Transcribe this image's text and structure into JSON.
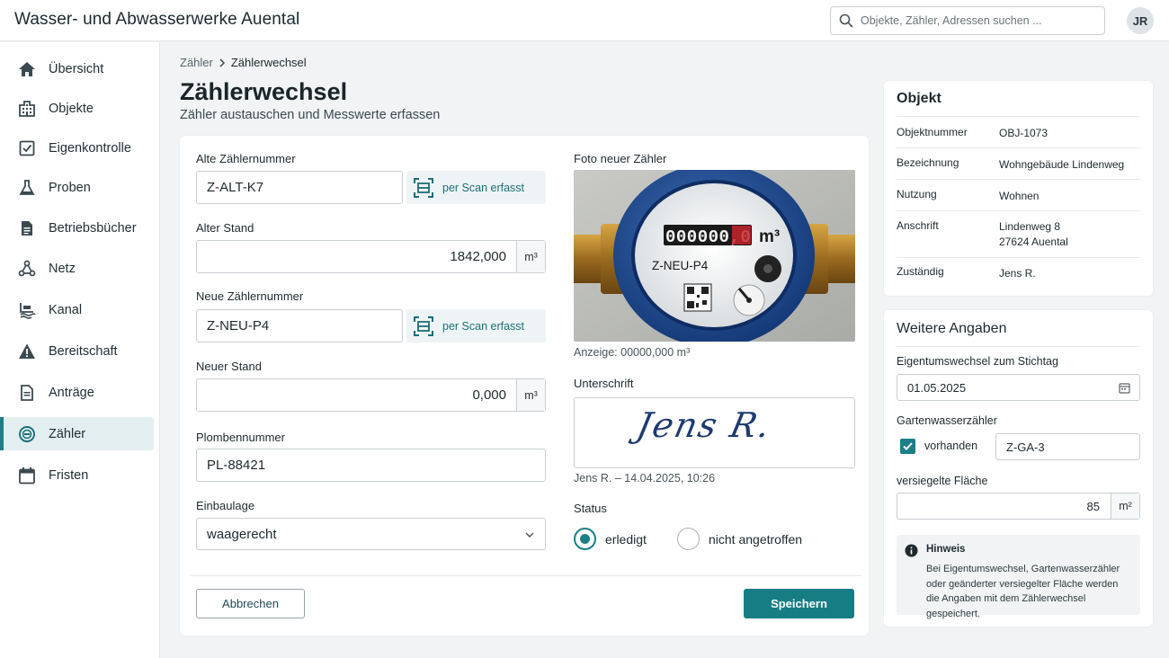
{
  "app": {
    "title": "Wasser- und Abwasserwerke Auental",
    "user_initials": "JR"
  },
  "search": {
    "placeholder": "Objekte, Zähler, Adressen suchen ..."
  },
  "sidebar": {
    "items": [
      {
        "label": "Übersicht",
        "icon": "home-icon"
      },
      {
        "label": "Objekte",
        "icon": "building-icon"
      },
      {
        "label": "Eigenkontrolle",
        "icon": "checklist-icon"
      },
      {
        "label": "Proben",
        "icon": "flask-icon"
      },
      {
        "label": "Betriebsbücher",
        "icon": "document-icon"
      },
      {
        "label": "Netz",
        "icon": "network-icon"
      },
      {
        "label": "Kanal",
        "icon": "sewer-icon"
      },
      {
        "label": "Bereitschaft",
        "icon": "warning-icon"
      },
      {
        "label": "Anträge",
        "icon": "document-icon"
      },
      {
        "label": "Zähler",
        "icon": "meter-icon"
      },
      {
        "label": "Fristen",
        "icon": "calendar-icon"
      }
    ],
    "active": "Zähler"
  },
  "breadcrumb": {
    "parent": "Zähler",
    "current": "Zählerwechsel"
  },
  "page": {
    "title": "Zählerwechsel",
    "subtitle": "Zähler austauschen und Messwerte erfassen"
  },
  "form": {
    "old_number": {
      "label": "Alte Zählernummer",
      "value": "Z-ALT-K7",
      "scan": "per Scan erfasst"
    },
    "old_reading": {
      "label": "Alter Stand",
      "value": "1842,000",
      "unit": "m³"
    },
    "new_number": {
      "label": "Neue Zählernummer",
      "value": "Z-NEU-P4",
      "scan": "per Scan erfasst"
    },
    "new_reading": {
      "label": "Neuer Stand",
      "value": "0,000",
      "unit": "m³"
    },
    "seal": {
      "label": "Plombennummer",
      "value": "PL-88421"
    },
    "position": {
      "label": "Einbaulage",
      "value": "waagerecht"
    },
    "photo": {
      "label": "Foto neuer Zähler",
      "caption": "Anzeige: 00000,000 m³",
      "display_digits": "000000,00",
      "display_unit": "m³",
      "meter_id": "Z-NEU-P4"
    },
    "signature": {
      "label": "Unterschrift",
      "text": "Jens R.",
      "caption": "Jens R. – 14.04.2025, 10:26"
    },
    "status": {
      "label": "Status",
      "options": [
        "erledigt",
        "nicht angetroffen"
      ],
      "selected": "erledigt"
    },
    "cancel": "Abbrechen",
    "save": "Speichern"
  },
  "object": {
    "title": "Objekt",
    "rows": [
      {
        "key": "Objektnummer",
        "value": "OBJ-1073"
      },
      {
        "key": "Bezeichnung",
        "value": "Wohngebäude Lindenweg"
      },
      {
        "key": "Nutzung",
        "value": "Wohnen"
      },
      {
        "key": "Anschrift",
        "value": "Lindenweg 8",
        "value2": "27624 Auental"
      },
      {
        "key": "Zuständig",
        "value": "Jens R."
      }
    ]
  },
  "more": {
    "title": "Weitere Angaben",
    "owner_change": {
      "label": "Eigentumswechsel zum Stichtag",
      "value": "01.05.2025"
    },
    "garden": {
      "label": "Gartenwasserzähler",
      "checkbox": "vorhanden",
      "checked": true,
      "value": "Z-GA-3"
    },
    "sealed": {
      "label": "versiegelte Fläche",
      "value": "85",
      "unit": "m²"
    },
    "hint": {
      "title": "Hinweis",
      "text": "Bei Eigentumswechsel, Gartenwasserzähler oder geänderter versiegelter Fläche werden die Angaben mit dem Zählerwechsel gespeichert."
    }
  },
  "colors": {
    "accent": "#1b7f86",
    "save_button": "#177d84"
  }
}
